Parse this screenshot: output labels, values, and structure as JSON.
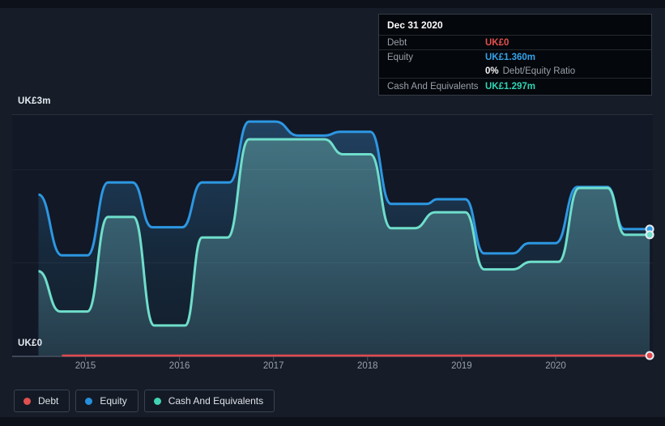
{
  "y_axis": {
    "max_label": "UK£3m",
    "min_label": "UK£0"
  },
  "tooltip": {
    "date": "Dec 31 2020",
    "debt_label": "Debt",
    "debt_value": "UK£0",
    "equity_label": "Equity",
    "equity_value": "UK£1.360m",
    "ratio_value": "0%",
    "ratio_label": "Debt/Equity Ratio",
    "cash_label": "Cash And Equivalents",
    "cash_value": "UK£1.297m"
  },
  "legend": {
    "items": [
      {
        "key": "debt",
        "label": "Debt",
        "color": "#e0504e"
      },
      {
        "key": "equity",
        "label": "Equity",
        "color": "#2590dd"
      },
      {
        "key": "cash",
        "label": "Cash And Equivalents",
        "color": "#41d3b4"
      }
    ]
  },
  "chart_data": {
    "type": "area",
    "x_ticks": [
      "2015",
      "2016",
      "2017",
      "2018",
      "2019",
      "2020"
    ],
    "x_domain": [
      2014.5,
      2021.0
    ],
    "y_unit": "UK£ millions",
    "ylim": [
      0,
      3
    ],
    "grid": "horizontal-faint",
    "legend_position": "bottom-left",
    "selected_point": {
      "date": "Dec 31 2020",
      "debt_m": 0,
      "equity_m": 1.36,
      "cash_m": 1.297,
      "debt_equity_ratio_pct": 0
    },
    "series": [
      {
        "key": "equity",
        "name": "Equity",
        "color": "#2d97e2",
        "points": [
          [
            2014.5,
            1.73
          ],
          [
            2014.75,
            1.08
          ],
          [
            2015.02,
            1.08
          ],
          [
            2015.24,
            1.86
          ],
          [
            2015.5,
            1.86
          ],
          [
            2015.71,
            1.38
          ],
          [
            2016.03,
            1.38
          ],
          [
            2016.24,
            1.86
          ],
          [
            2016.53,
            1.86
          ],
          [
            2016.74,
            2.51
          ],
          [
            2017.02,
            2.51
          ],
          [
            2017.26,
            2.36
          ],
          [
            2017.54,
            2.36
          ],
          [
            2017.71,
            2.4
          ],
          [
            2018.03,
            2.4
          ],
          [
            2018.25,
            1.63
          ],
          [
            2018.63,
            1.63
          ],
          [
            2018.74,
            1.68
          ],
          [
            2019.04,
            1.68
          ],
          [
            2019.24,
            1.1
          ],
          [
            2019.54,
            1.1
          ],
          [
            2019.72,
            1.21
          ],
          [
            2020.0,
            1.21
          ],
          [
            2020.23,
            1.81
          ],
          [
            2020.55,
            1.81
          ],
          [
            2020.73,
            1.36
          ],
          [
            2021.0,
            1.36
          ]
        ]
      },
      {
        "key": "cash",
        "name": "Cash And Equivalents",
        "color": "#6fdecb",
        "points": [
          [
            2014.5,
            0.91
          ],
          [
            2014.73,
            0.48
          ],
          [
            2015.02,
            0.48
          ],
          [
            2015.24,
            1.49
          ],
          [
            2015.51,
            1.49
          ],
          [
            2015.73,
            0.33
          ],
          [
            2016.06,
            0.33
          ],
          [
            2016.24,
            1.27
          ],
          [
            2016.51,
            1.27
          ],
          [
            2016.74,
            2.32
          ],
          [
            2017.54,
            2.32
          ],
          [
            2017.74,
            2.16
          ],
          [
            2018.03,
            2.16
          ],
          [
            2018.25,
            1.37
          ],
          [
            2018.5,
            1.37
          ],
          [
            2018.72,
            1.54
          ],
          [
            2019.04,
            1.54
          ],
          [
            2019.24,
            0.93
          ],
          [
            2019.54,
            0.93
          ],
          [
            2019.74,
            1.01
          ],
          [
            2020.03,
            1.01
          ],
          [
            2020.25,
            1.8
          ],
          [
            2020.55,
            1.8
          ],
          [
            2020.74,
            1.3
          ],
          [
            2021.0,
            1.3
          ]
        ]
      },
      {
        "key": "debt",
        "name": "Debt",
        "color": "#e0494f",
        "points": [
          [
            2014.75,
            0
          ],
          [
            2021.0,
            0
          ]
        ]
      }
    ]
  }
}
